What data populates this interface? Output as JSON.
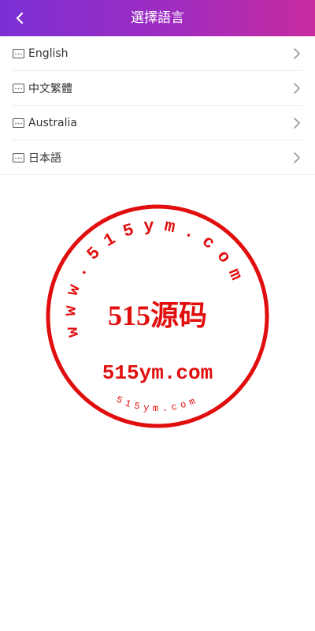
{
  "header": {
    "title": "選擇語言",
    "back_icon": "chevron-left-icon",
    "gradient": [
      "#7a2fd4",
      "#c72b9e"
    ]
  },
  "languages": [
    {
      "label": "English",
      "icon": "document-icon",
      "chevron": "chevron-right-icon"
    },
    {
      "label": "中文繁體",
      "icon": "document-icon",
      "chevron": "chevron-right-icon"
    },
    {
      "label": "Australia",
      "icon": "document-icon",
      "chevron": "chevron-right-icon"
    },
    {
      "label": "日本語",
      "icon": "document-icon",
      "chevron": "chevron-right-icon"
    }
  ],
  "watermark": {
    "arc_text": "www.515ym.com",
    "center_text": "515源码",
    "domain_text": "515ym.com",
    "bottom_text": "515ym.com",
    "color": "#e10e0e"
  }
}
